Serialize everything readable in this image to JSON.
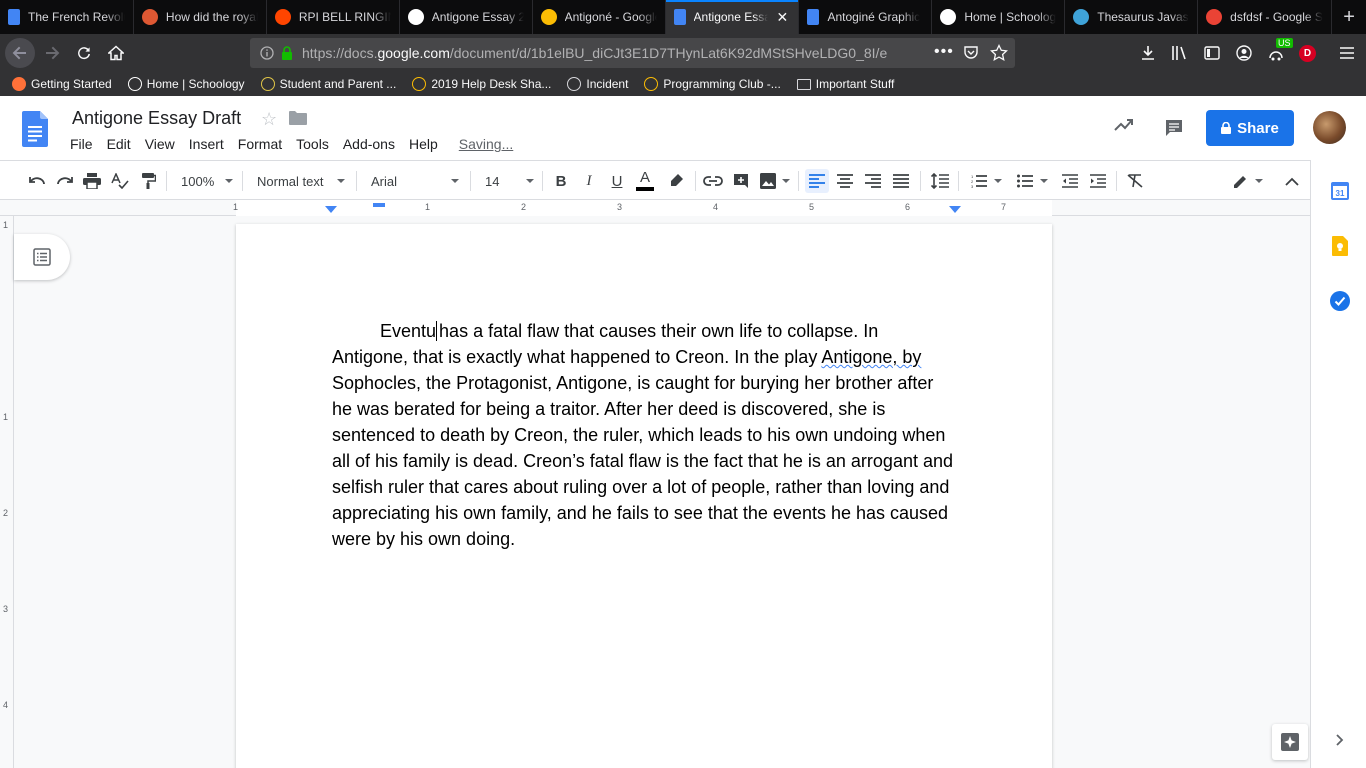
{
  "browser": {
    "tabs": [
      {
        "label": "The French Revolution",
        "icon": "google-docs-icon",
        "color": "#4285f4"
      },
      {
        "label": "How did the royal family",
        "icon": "duckduckgo-icon",
        "color": "#de5833"
      },
      {
        "label": "RPI BELL RINGING",
        "icon": "reddit-icon",
        "color": "#ff4500"
      },
      {
        "label": "Antigone Essay 2",
        "icon": "schoology-icon",
        "color": "#ffffff"
      },
      {
        "label": "Antigoné - Google",
        "icon": "google-drive-icon",
        "color": "#fbbc04"
      },
      {
        "label": "Antigone Essay",
        "icon": "google-docs-icon",
        "color": "#4285f4",
        "active": true
      },
      {
        "label": "Antoginé Graphic",
        "icon": "google-docs-icon",
        "color": "#4285f4"
      },
      {
        "label": "Home | Schoology",
        "icon": "schoology-icon",
        "color": "#ffffff"
      },
      {
        "label": "Thesaurus Javascript",
        "icon": "puzzle-icon",
        "color": "#3fa3d9"
      },
      {
        "label": "dsfdsf - Google Search",
        "icon": "google-icon",
        "color": "#ea4335"
      }
    ],
    "url_prefix": "https://docs.",
    "url_domain": "google.com",
    "url_rest": "/document/d/1b1elBU_diCJt3E1D7THynLat6K92dMStSHveLDG0_8I/e",
    "bookmarks": [
      {
        "label": "Getting Started",
        "icon": "firefox-icon"
      },
      {
        "label": "Home | Schoology",
        "icon": "schoology-icon"
      },
      {
        "label": "Student and Parent ...",
        "icon": "pearson-icon"
      },
      {
        "label": "2019 Help Desk Sha...",
        "icon": "google-drive-icon"
      },
      {
        "label": "Incident",
        "icon": "globe-icon"
      },
      {
        "label": "Programming Club -...",
        "icon": "google-drive-icon"
      },
      {
        "label": "Important Stuff",
        "icon": "folder-icon"
      }
    ],
    "profile_initial": "D",
    "badge_text": "US"
  },
  "docs": {
    "title": "Antigone Essay Draft",
    "menu": [
      "File",
      "Edit",
      "View",
      "Insert",
      "Format",
      "Tools",
      "Add-ons",
      "Help"
    ],
    "saving_status": "Saving...",
    "share_label": "Share",
    "accent_color": "#1a73e8"
  },
  "toolbar": {
    "zoom": "100%",
    "style": "Normal text",
    "font": "Arial",
    "font_size": "14"
  },
  "ruler": {
    "h_labels": [
      "1",
      "1",
      "2",
      "3",
      "4",
      "5",
      "6",
      "7"
    ],
    "v_labels": [
      "1",
      "1",
      "2",
      "3",
      "4"
    ]
  },
  "document": {
    "typed_prefix": "Eventu",
    "text_before_link": "has a fatal flaw that causes their own life to collapse. In Antigone, that is exactly what happened to Creon. In the play ",
    "squiggle_text": "Antigone, by",
    "text_after_link": " Sophocles, the Protagonist, Antigone, is caught for burying her brother after he was berated for being a traitor. After her deed is discovered, she is sentenced to death by Creon, the ruler, which leads to his own undoing when all of his family is dead. Creon’s fatal flaw is the fact that he is an arrogant and selfish ruler that cares about ruling over a lot of people, rather than loving and appreciating his own family, and he fails to see that the events he has caused were by his own doing."
  },
  "sidepanel": {
    "calendar_day": "31"
  }
}
